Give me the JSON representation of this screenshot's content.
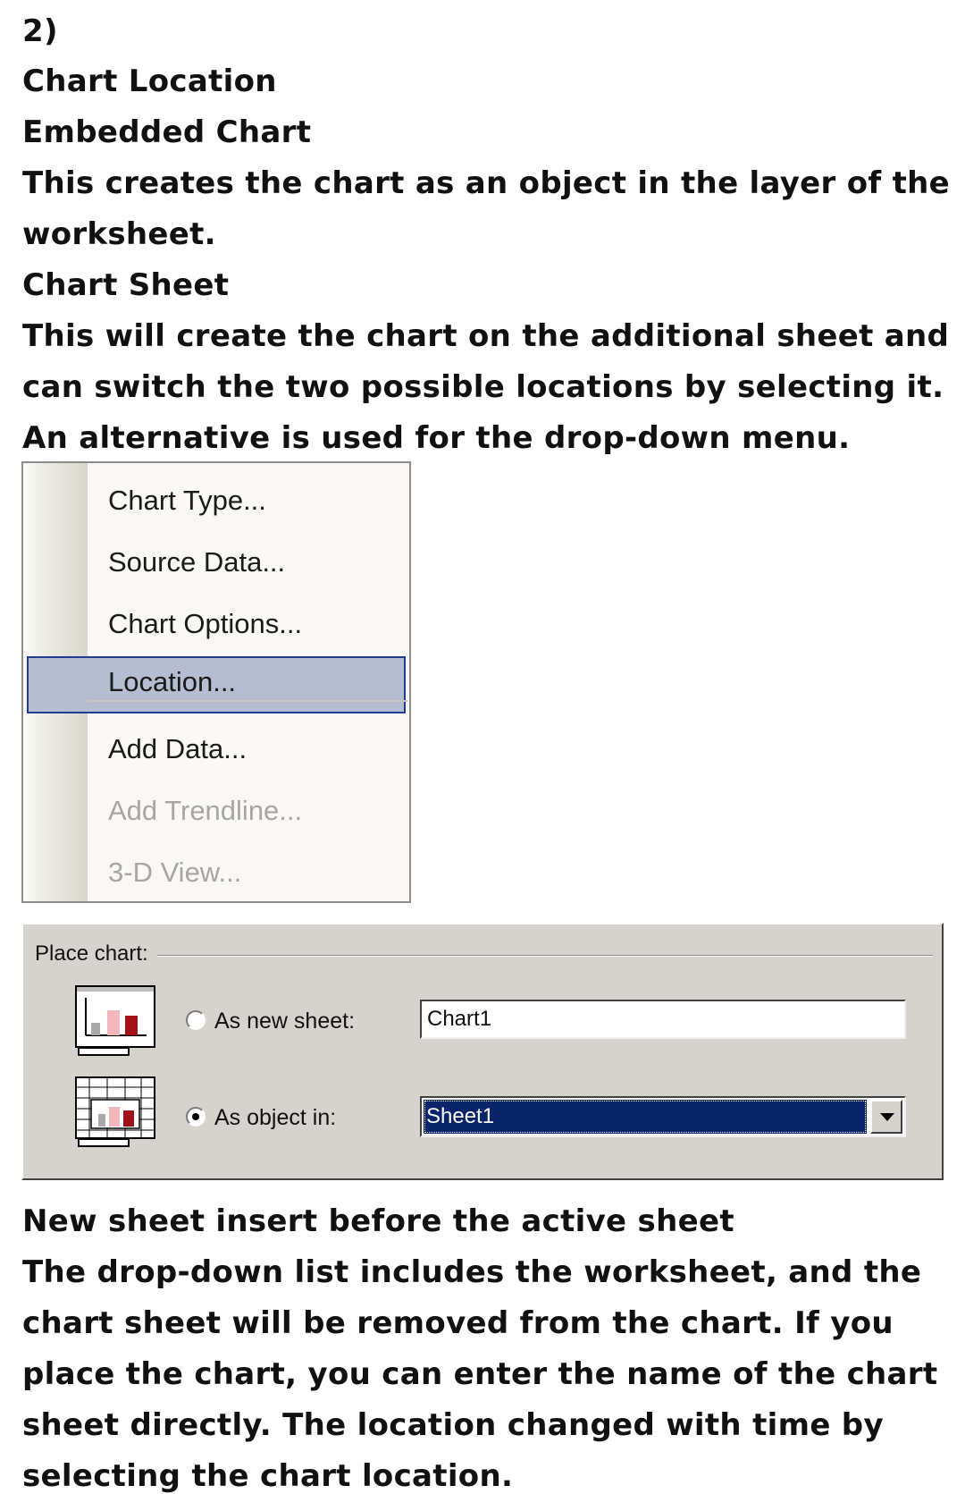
{
  "paragraphs_top": [
    "2)",
    "Chart Location",
    "Embedded Chart",
    "This creates the chart as an object in the layer of the",
    "worksheet.",
    "Chart Sheet",
    "This will create the chart on the additional sheet and",
    "can switch the two possible locations by selecting it.",
    "An alternative is used for the drop-down menu."
  ],
  "menu": {
    "items": [
      {
        "label": "Chart Type...",
        "enabled": true,
        "selected": false
      },
      {
        "label": "Source Data...",
        "enabled": true,
        "selected": false
      },
      {
        "label": "Chart Options...",
        "enabled": true,
        "selected": false
      },
      {
        "label": "Location...",
        "enabled": true,
        "selected": true
      },
      {
        "label": "Add Data...",
        "enabled": true,
        "selected": false
      },
      {
        "label": "Add Trendline...",
        "enabled": false,
        "selected": false
      },
      {
        "label": "3-D View...",
        "enabled": false,
        "selected": false
      }
    ],
    "highlight_color": "#b6bdd2"
  },
  "place_chart": {
    "group_label": "Place chart:",
    "new_sheet_label": "As new sheet:",
    "new_sheet_value": "Chart1",
    "object_in_label": "As object in:",
    "object_in_value": "Sheet1",
    "selected_option": "As object in:"
  },
  "paragraphs_bottom": [
    "New sheet insert before the active sheet",
    "The drop-down list includes the worksheet, and the",
    "chart sheet will be removed from the chart. If you",
    "place the chart, you can enter the name of the chart",
    "sheet directly. The location changed with time by",
    "selecting the chart location."
  ]
}
